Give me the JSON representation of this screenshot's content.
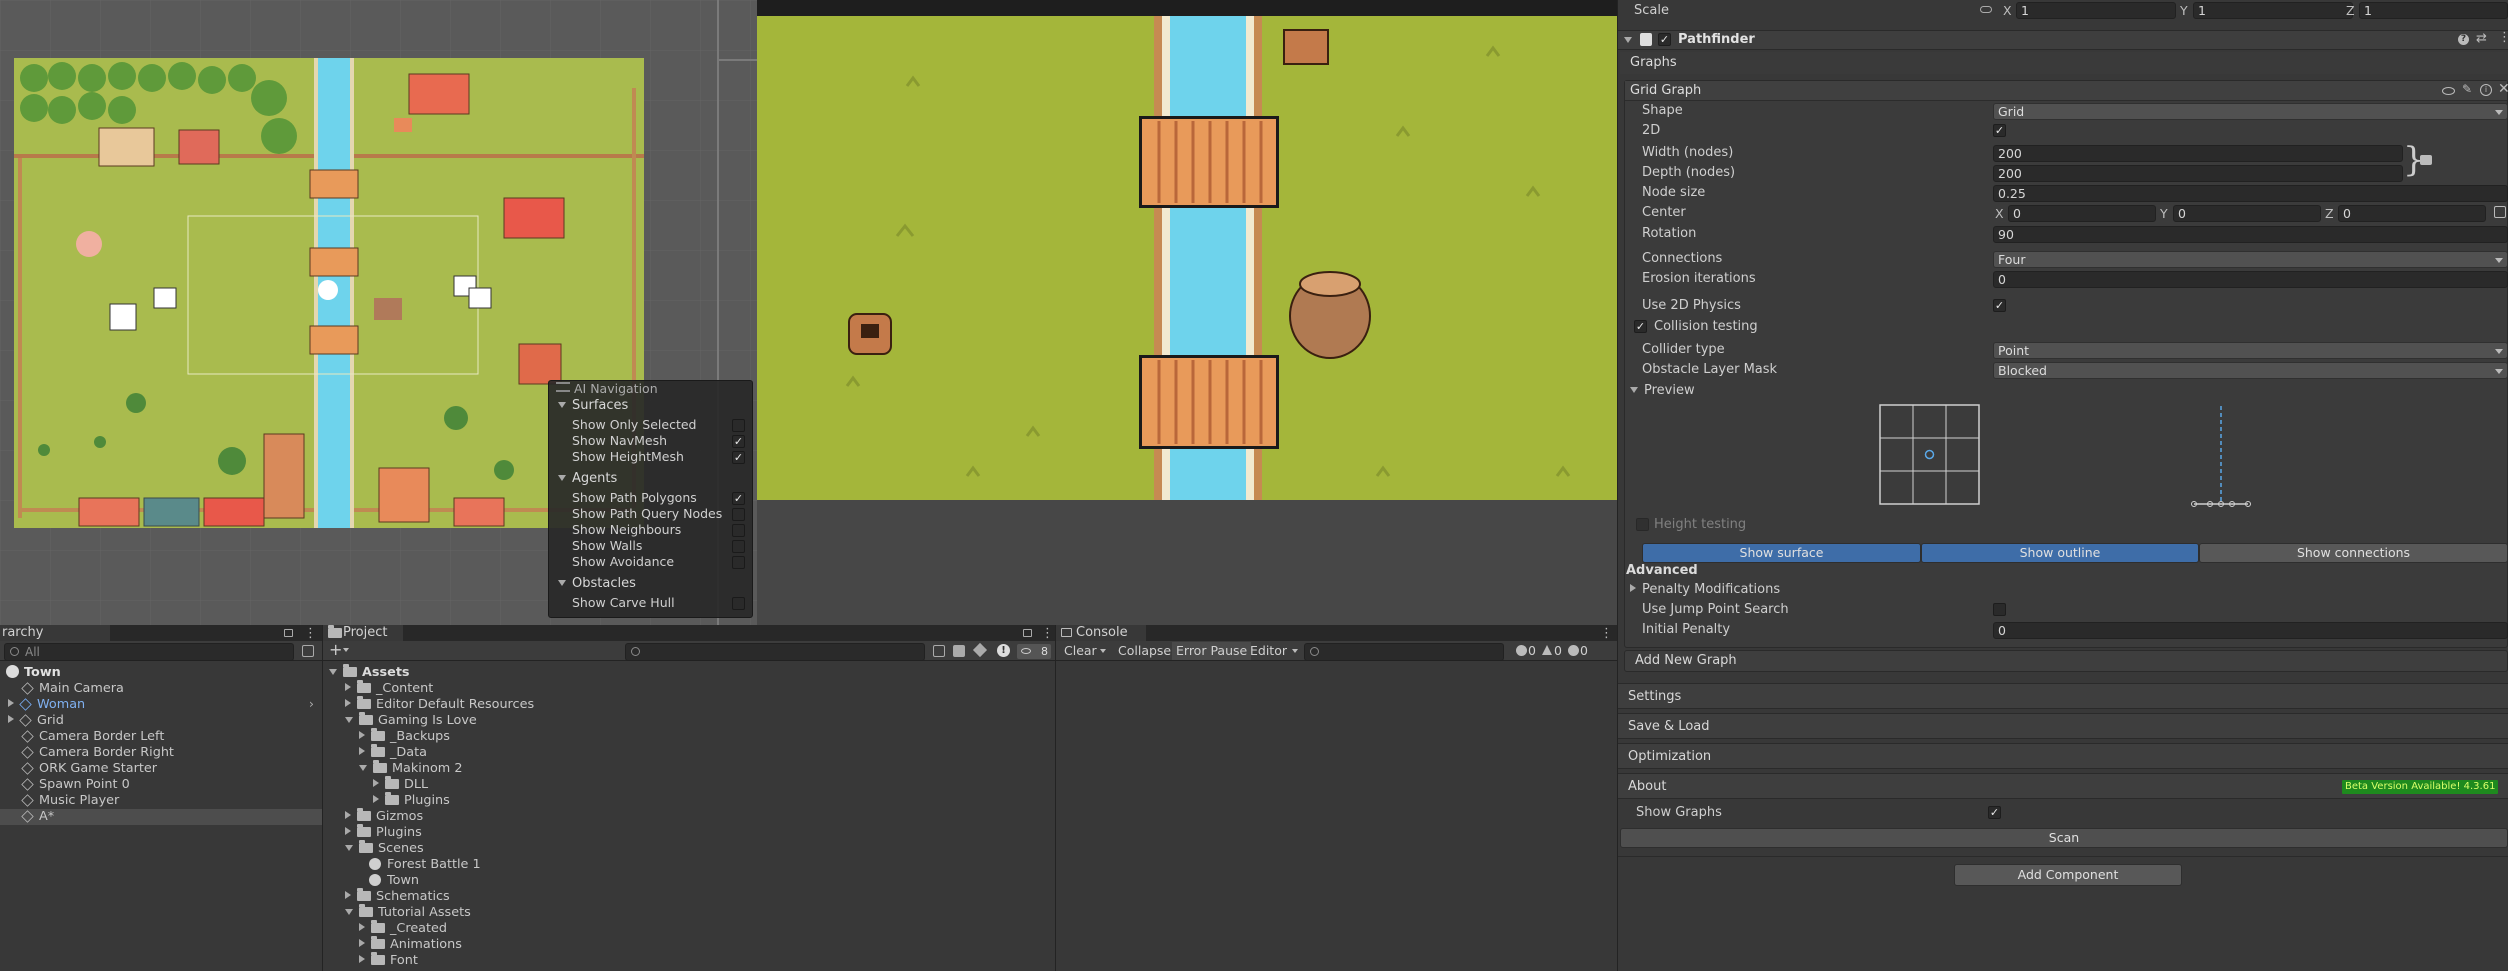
{
  "scene_overlay": {
    "title": "AI Navigation",
    "sections": [
      {
        "label": "Surfaces",
        "items": [
          {
            "label": "Show Only Selected",
            "checked": false
          },
          {
            "label": "Show NavMesh",
            "checked": true
          },
          {
            "label": "Show HeightMesh",
            "checked": true
          }
        ]
      },
      {
        "label": "Agents",
        "items": [
          {
            "label": "Show Path Polygons",
            "checked": true
          },
          {
            "label": "Show Path Query Nodes",
            "checked": false
          },
          {
            "label": "Show Neighbours",
            "checked": false
          },
          {
            "label": "Show Walls",
            "checked": false
          },
          {
            "label": "Show Avoidance",
            "checked": false
          }
        ]
      },
      {
        "label": "Obstacles",
        "items": [
          {
            "label": "Show Carve Hull",
            "checked": false
          }
        ]
      }
    ]
  },
  "hierarchy": {
    "tab_label": "Hierarchy",
    "tab_label_visible": "rarchy",
    "search_placeholder": "All",
    "scene_name": "Town",
    "items": [
      {
        "label": "Main Camera",
        "highlight": false,
        "foldable": false
      },
      {
        "label": "Woman",
        "highlight": true,
        "foldable": true
      },
      {
        "label": "Grid",
        "highlight": false,
        "foldable": true
      },
      {
        "label": "Camera Border Left",
        "highlight": false,
        "foldable": false
      },
      {
        "label": "Camera Border Right",
        "highlight": false,
        "foldable": false
      },
      {
        "label": "ORK Game Starter",
        "highlight": false,
        "foldable": false
      },
      {
        "label": "Spawn Point 0",
        "highlight": false,
        "foldable": false
      },
      {
        "label": "Music Player",
        "highlight": false,
        "foldable": false
      },
      {
        "label": "A*",
        "highlight": false,
        "foldable": false,
        "selected": true
      }
    ]
  },
  "project": {
    "tab_label": "Project",
    "hidden_count": "8",
    "root": "Assets",
    "items": [
      {
        "label": "_Content",
        "depth": 1,
        "state": "closed",
        "type": "folder"
      },
      {
        "label": "Editor Default Resources",
        "depth": 1,
        "state": "closed",
        "type": "folder"
      },
      {
        "label": "Gaming Is Love",
        "depth": 1,
        "state": "open",
        "type": "folder"
      },
      {
        "label": "_Backups",
        "depth": 2,
        "state": "closed",
        "type": "folder"
      },
      {
        "label": "_Data",
        "depth": 2,
        "state": "closed",
        "type": "folder"
      },
      {
        "label": "Makinom 2",
        "depth": 2,
        "state": "open",
        "type": "folder"
      },
      {
        "label": "DLL",
        "depth": 3,
        "state": "closed",
        "type": "folder"
      },
      {
        "label": "Plugins",
        "depth": 3,
        "state": "closed",
        "type": "folder"
      },
      {
        "label": "Gizmos",
        "depth": 1,
        "state": "closed",
        "type": "folder"
      },
      {
        "label": "Plugins",
        "depth": 1,
        "state": "closed",
        "type": "folder"
      },
      {
        "label": "Scenes",
        "depth": 1,
        "state": "open",
        "type": "folder"
      },
      {
        "label": "Forest Battle 1",
        "depth": 2,
        "state": "none",
        "type": "scene"
      },
      {
        "label": "Town",
        "depth": 2,
        "state": "none",
        "type": "scene"
      },
      {
        "label": "Schematics",
        "depth": 1,
        "state": "closed",
        "type": "folder"
      },
      {
        "label": "Tutorial Assets",
        "depth": 1,
        "state": "open",
        "type": "folder"
      },
      {
        "label": "_Created",
        "depth": 2,
        "state": "closed",
        "type": "folder"
      },
      {
        "label": "Animations",
        "depth": 2,
        "state": "closed",
        "type": "folder"
      },
      {
        "label": "Font",
        "depth": 2,
        "state": "closed",
        "type": "folder"
      }
    ]
  },
  "console": {
    "tab_label": "Console",
    "clear": "Clear",
    "collapse": "Collapse",
    "error_pause": "Error Pause",
    "editor": "Editor",
    "count_log": "0",
    "count_warn": "0",
    "count_error": "0"
  },
  "inspector": {
    "scale_label": "Scale",
    "scale_x": "1",
    "scale_y": "1",
    "scale_z": "1",
    "component_title": "Pathfinder",
    "graphs_header": "Graphs",
    "graph_title": "Grid Graph",
    "shape_label": "Shape",
    "shape_value": "Grid",
    "twod_label": "2D",
    "width_label": "Width (nodes)",
    "width_value": "200",
    "depth_label": "Depth (nodes)",
    "depth_value": "200",
    "node_size_label": "Node size",
    "node_size_value": "0.25",
    "center_label": "Center",
    "center_x": "0",
    "center_y": "0",
    "center_z": "0",
    "rotation_label": "Rotation",
    "rotation_value": "90",
    "connections_label": "Connections",
    "connections_value": "Four",
    "erosion_label": "Erosion iterations",
    "erosion_value": "0",
    "use2d_label": "Use 2D Physics",
    "collision_label": "Collision testing",
    "collider_type_label": "Collider type",
    "collider_type_value": "Point",
    "obstacle_label": "Obstacle Layer Mask",
    "obstacle_value": "Blocked",
    "preview_label": "Preview",
    "height_testing_label": "Height testing",
    "show_surface": "Show surface",
    "show_outline": "Show outline",
    "show_connections": "Show connections",
    "advanced_label": "Advanced",
    "penalty_label": "Penalty Modifications",
    "jump_label": "Use Jump Point Search",
    "initial_penalty_label": "Initial Penalty",
    "initial_penalty_value": "0",
    "add_new_graph": "Add New Graph",
    "settings": "Settings",
    "save_load": "Save & Load",
    "optimization": "Optimization",
    "about": "About",
    "beta_badge": "Beta Version Available! 4.3.61",
    "show_graphs_label": "Show Graphs",
    "scan": "Scan",
    "add_component": "Add Component"
  },
  "colors": {
    "accent": "#3a7ed8",
    "grass": "#a4b63a",
    "water": "#6ed3ec",
    "bridge": "#e89a5a",
    "beta_green": "#1e8a1e"
  }
}
